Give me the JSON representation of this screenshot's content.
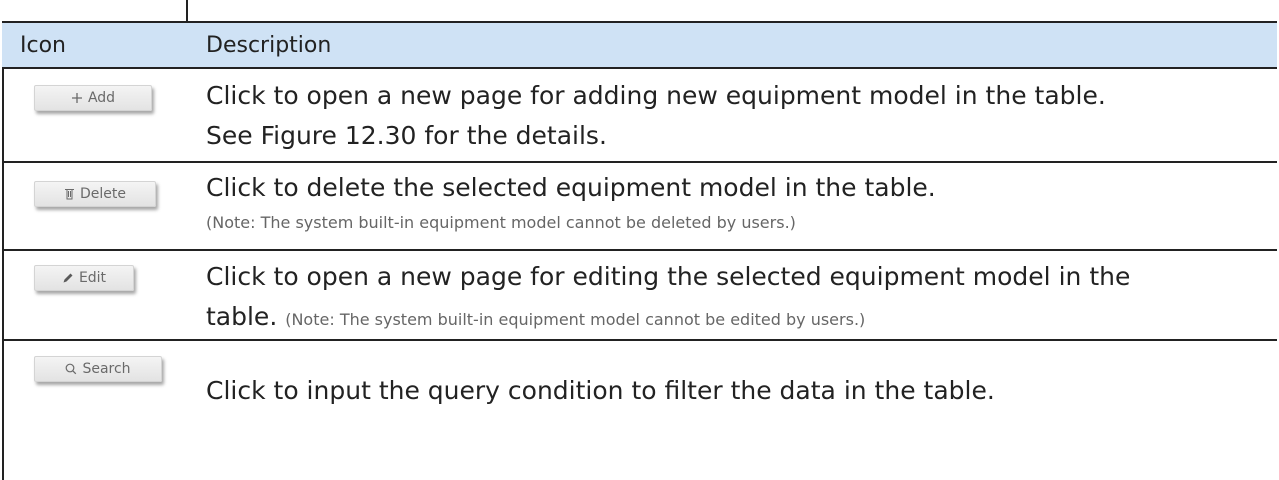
{
  "header": {
    "icon_col": "Icon",
    "desc_col": "Description"
  },
  "rows": [
    {
      "button": {
        "label": "Add",
        "icon": "plus-icon"
      },
      "line1": "Click to open a new page for adding new equipment model in the table.",
      "line2": "See Figure 12.30 for the details."
    },
    {
      "button": {
        "label": "Delete",
        "icon": "trash-icon"
      },
      "line1": "Click to delete the selected equipment model in the table.",
      "note": "(Note: The system built-in equipment model cannot be deleted by users.)"
    },
    {
      "button": {
        "label": "Edit",
        "icon": "pencil-icon"
      },
      "line1": "Click to open a new page for editing the selected equipment model in the",
      "line2_main": "table.",
      "line2_note": "(Note: The system built-in equipment model cannot be edited by users.)"
    },
    {
      "button": {
        "label": "Search",
        "icon": "search-icon"
      },
      "line1": "Click to input the query condition to filter the data in the table."
    }
  ]
}
